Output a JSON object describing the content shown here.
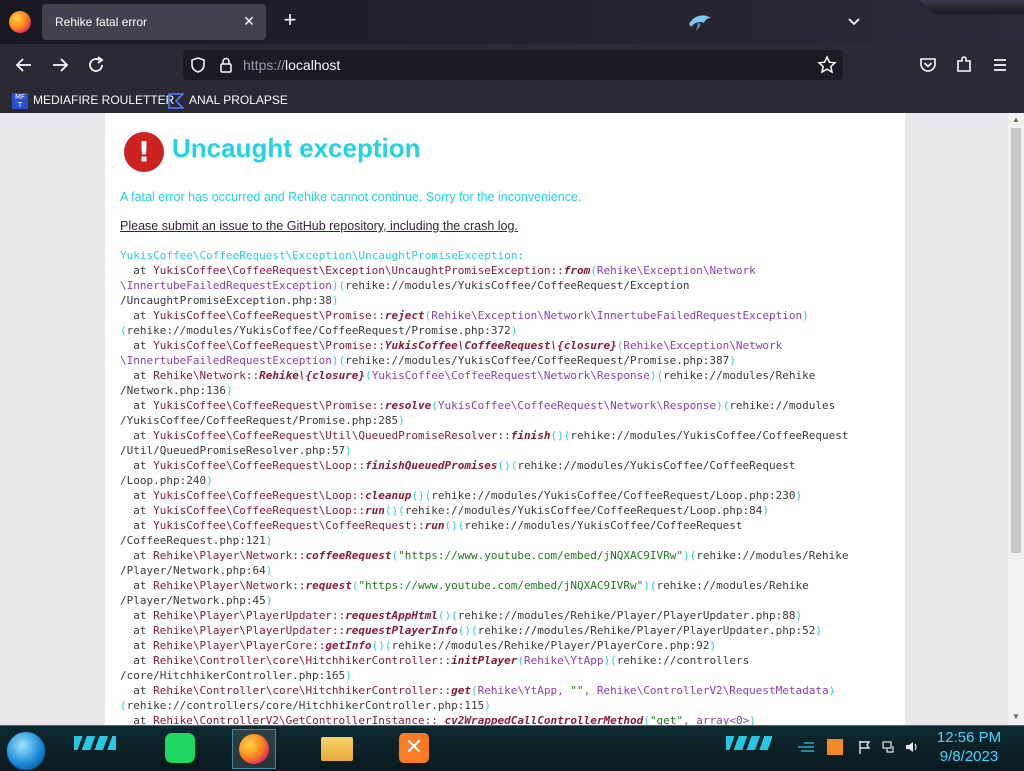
{
  "browser": {
    "tab_title": "Rehike fatal error",
    "url_scheme": "https://",
    "url_host": "localhost"
  },
  "bookmarks": [
    {
      "label": "MEDIAFIRE ROULETTER",
      "icon": "mediafire-icon"
    },
    {
      "label": "ANAL PROLAPSE",
      "icon": "bookmark-logo-icon"
    }
  ],
  "page": {
    "title": "Uncaught exception",
    "message": "A fatal error has occurred and Rehike cannot continue. Sorry for the inconvenience.",
    "link_text": "Please submit an issue to the GitHub repository, including the crash log.",
    "exception_header": "YukisCoffee\\CoffeeRequest\\Exception\\UncaughtPromiseException:",
    "trace_lines": [
      "  at YukisCoffee\\CoffeeRequest\\Exception\\UncaughtPromiseException::from(Rehike\\Exception\\Network",
      "\\InnertubeFailedRequestException)(rehike://modules/YukisCoffee/CoffeeRequest/Exception",
      "/UncaughtPromiseException.php:38)",
      "  at YukisCoffee\\CoffeeRequest\\Promise::reject(Rehike\\Exception\\Network\\InnertubeFailedRequestException)",
      "(rehike://modules/YukisCoffee/CoffeeRequest/Promise.php:372)",
      "  at YukisCoffee\\CoffeeRequest\\Promise::YukisCoffee\\CoffeeRequest\\{closure}(Rehike\\Exception\\Network",
      "\\InnertubeFailedRequestException)(rehike://modules/YukisCoffee/CoffeeRequest/Promise.php:387)",
      "  at Rehike\\Network::Rehike\\{closure}(YukisCoffee\\CoffeeRequest\\Network\\Response)(rehike://modules/Rehike",
      "/Network.php:136)",
      "  at YukisCoffee\\CoffeeRequest\\Promise::resolve(YukisCoffee\\CoffeeRequest\\Network\\Response)(rehike://modules",
      "/YukisCoffee/CoffeeRequest/Promise.php:285)",
      "  at YukisCoffee\\CoffeeRequest\\Util\\QueuedPromiseResolver::finish()(rehike://modules/YukisCoffee/CoffeeRequest",
      "/Util/QueuedPromiseResolver.php:57)",
      "  at YukisCoffee\\CoffeeRequest\\Loop::finishQueuedPromises()(rehike://modules/YukisCoffee/CoffeeRequest",
      "/Loop.php:240)",
      "  at YukisCoffee\\CoffeeRequest\\Loop::cleanup()(rehike://modules/YukisCoffee/CoffeeRequest/Loop.php:230)",
      "  at YukisCoffee\\CoffeeRequest\\Loop::run()(rehike://modules/YukisCoffee/CoffeeRequest/Loop.php:84)",
      "  at YukisCoffee\\CoffeeRequest\\CoffeeRequest::run()(rehike://modules/YukisCoffee/CoffeeRequest",
      "/CoffeeRequest.php:121)",
      "  at Rehike\\Player\\Network::coffeeRequest(\"https://www.youtube.com/embed/jNQXAC9IVRw\")(rehike://modules/Rehike",
      "/Player/Network.php:64)",
      "  at Rehike\\Player\\Network::request(\"https://www.youtube.com/embed/jNQXAC9IVRw\")(rehike://modules/Rehike",
      "/Player/Network.php:45)",
      "  at Rehike\\Player\\PlayerUpdater::requestAppHtml()(rehike://modules/Rehike/Player/PlayerUpdater.php:88)",
      "  at Rehike\\Player\\PlayerUpdater::requestPlayerInfo()(rehike://modules/Rehike/Player/PlayerUpdater.php:52)",
      "  at Rehike\\Player\\PlayerCore::getInfo()(rehike://modules/Rehike/Player/PlayerCore.php:92)",
      "  at Rehike\\Controller\\core\\HitchhikerController::initPlayer(Rehike\\YtApp)(rehike://controllers",
      "/core/HitchhikerController.php:165)",
      "  at Rehike\\Controller\\core\\HitchhikerController::get(Rehike\\YtApp, \"\", Rehike\\ControllerV2\\RequestMetadata)",
      "(rehike://controllers/core/HitchhikerController.php:115)",
      "  at Rehike\\ControllerV2\\GetControllerInstance::_cv2WrappedCallControllerMethod(\"get\", array<0>)"
    ]
  },
  "taskbar": {
    "time": "12:56 PM",
    "date": "9/8/2023"
  },
  "colors": {
    "accent_cyan": "#22d3e0",
    "error_red": "#cc2222",
    "trace_class": "#8b1a36",
    "trace_arg": "#8a3db8",
    "trace_string": "#1f7a1f"
  }
}
